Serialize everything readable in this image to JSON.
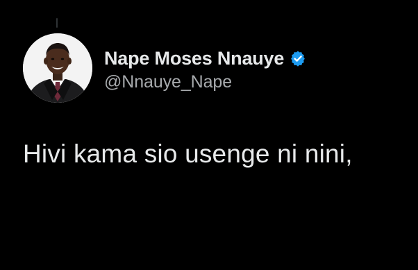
{
  "tweet": {
    "author": {
      "display_name": "Nape Moses Nnauye",
      "handle": "@Nnauye_Nape",
      "verified": true,
      "avatar_icon": "profile-photo"
    },
    "text": "Hivi kama sio usenge ni nini,"
  },
  "colors": {
    "background": "#000000",
    "text_primary": "#e7e9ea",
    "text_secondary": "#a7aaad",
    "verified_badge": "#1d9bf0"
  }
}
